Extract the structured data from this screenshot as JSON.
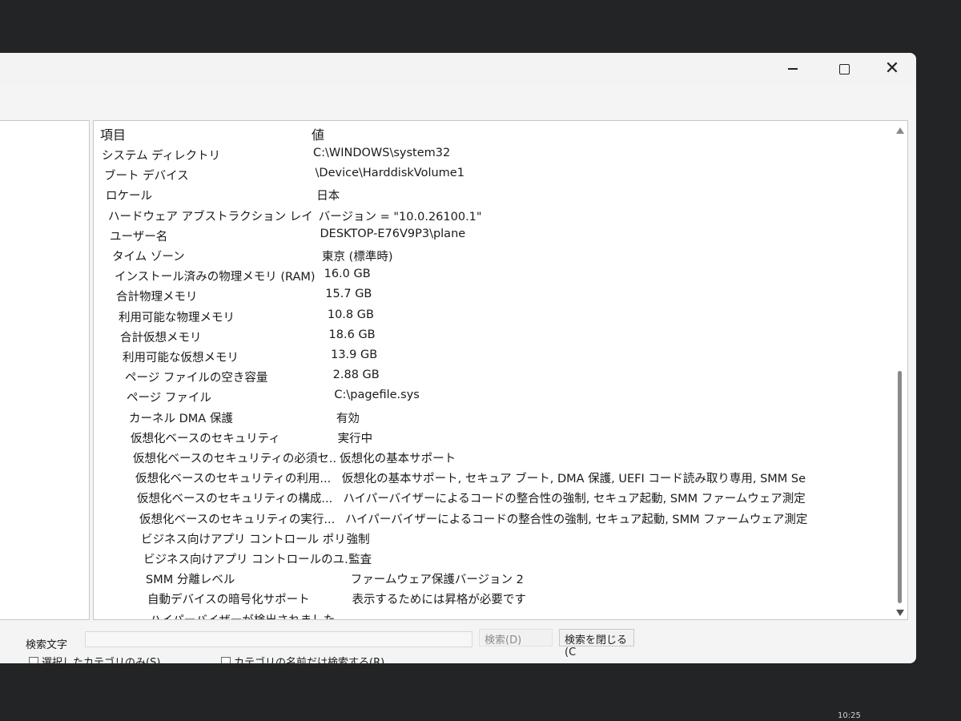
{
  "window": {
    "minimize_label": "",
    "maximize_label": "",
    "close_label": "✕"
  },
  "list": {
    "header_item": "項目",
    "header_value": "値",
    "rows": [
      {
        "key": "システム ディレクトリ",
        "value": "C:\\WINDOWS\\system32"
      },
      {
        "key": "ブート デバイス",
        "value": "\\Device\\HarddiskVolume1"
      },
      {
        "key": "ロケール",
        "value": "日本"
      },
      {
        "key": "ハードウェア アブストラクション レイヤー",
        "value": "バージョン = \"10.0.26100.1\""
      },
      {
        "key": "ユーザー名",
        "value": "DESKTOP-E76V9P3\\plane"
      },
      {
        "key": "タイム ゾーン",
        "value": "東京 (標準時)"
      },
      {
        "key": "インストール済みの物理メモリ (RAM)",
        "value": "16.0 GB"
      },
      {
        "key": "合計物理メモリ",
        "value": "15.7 GB"
      },
      {
        "key": "利用可能な物理メモリ",
        "value": "10.8 GB"
      },
      {
        "key": "合計仮想メモリ",
        "value": "18.6 GB"
      },
      {
        "key": "利用可能な仮想メモリ",
        "value": "13.9 GB"
      },
      {
        "key": "ページ ファイルの空き容量",
        "value": "2.88 GB"
      },
      {
        "key": "ページ ファイル",
        "value": "C:\\pagefile.sys"
      },
      {
        "key": "カーネル DMA 保護",
        "value": "有効"
      },
      {
        "key": "仮想化ベースのセキュリティ",
        "value": "実行中"
      },
      {
        "key": "仮想化ベースのセキュリティの必須セ...",
        "value": "仮想化の基本サポート"
      },
      {
        "key": "仮想化ベースのセキュリティの利用...",
        "value": "仮想化の基本サポート, セキュア ブート, DMA 保護, UEFI コード読み取り専用, SMM Se..."
      },
      {
        "key": "仮想化ベースのセキュリティの構成...",
        "value": "ハイパーバイザーによるコードの整合性の強制, セキュア起動, SMM ファームウェア測定"
      },
      {
        "key": "仮想化ベースのセキュリティの実行...",
        "value": "ハイパーバイザーによるコードの整合性の強制, セキュア起動, SMM ファームウェア測定"
      },
      {
        "key": "ビジネス向けアプリ コントロール ポリ...",
        "value": "強制"
      },
      {
        "key": "ビジネス向けアプリ コントロールのユ...",
        "value": "監査"
      },
      {
        "key": "SMM 分離レベル",
        "value": "ファームウェア保護バージョン 2"
      },
      {
        "key": "自動デバイスの暗号化サポート",
        "value": "表示するためには昇格が必要です"
      },
      {
        "key": "ハイパーバイザーが検出されました。...",
        "value": ""
      }
    ]
  },
  "find": {
    "label": "検索文字",
    "input_value": "",
    "search_button": "検索(D)",
    "close_button": "検索を閉じる(C",
    "checkbox_selected_category": "選択したカテゴリのみ(S)",
    "checkbox_category_names": "カテゴリの名前だけ検索する(R)"
  },
  "taskbar": {
    "clock": "10:25"
  }
}
